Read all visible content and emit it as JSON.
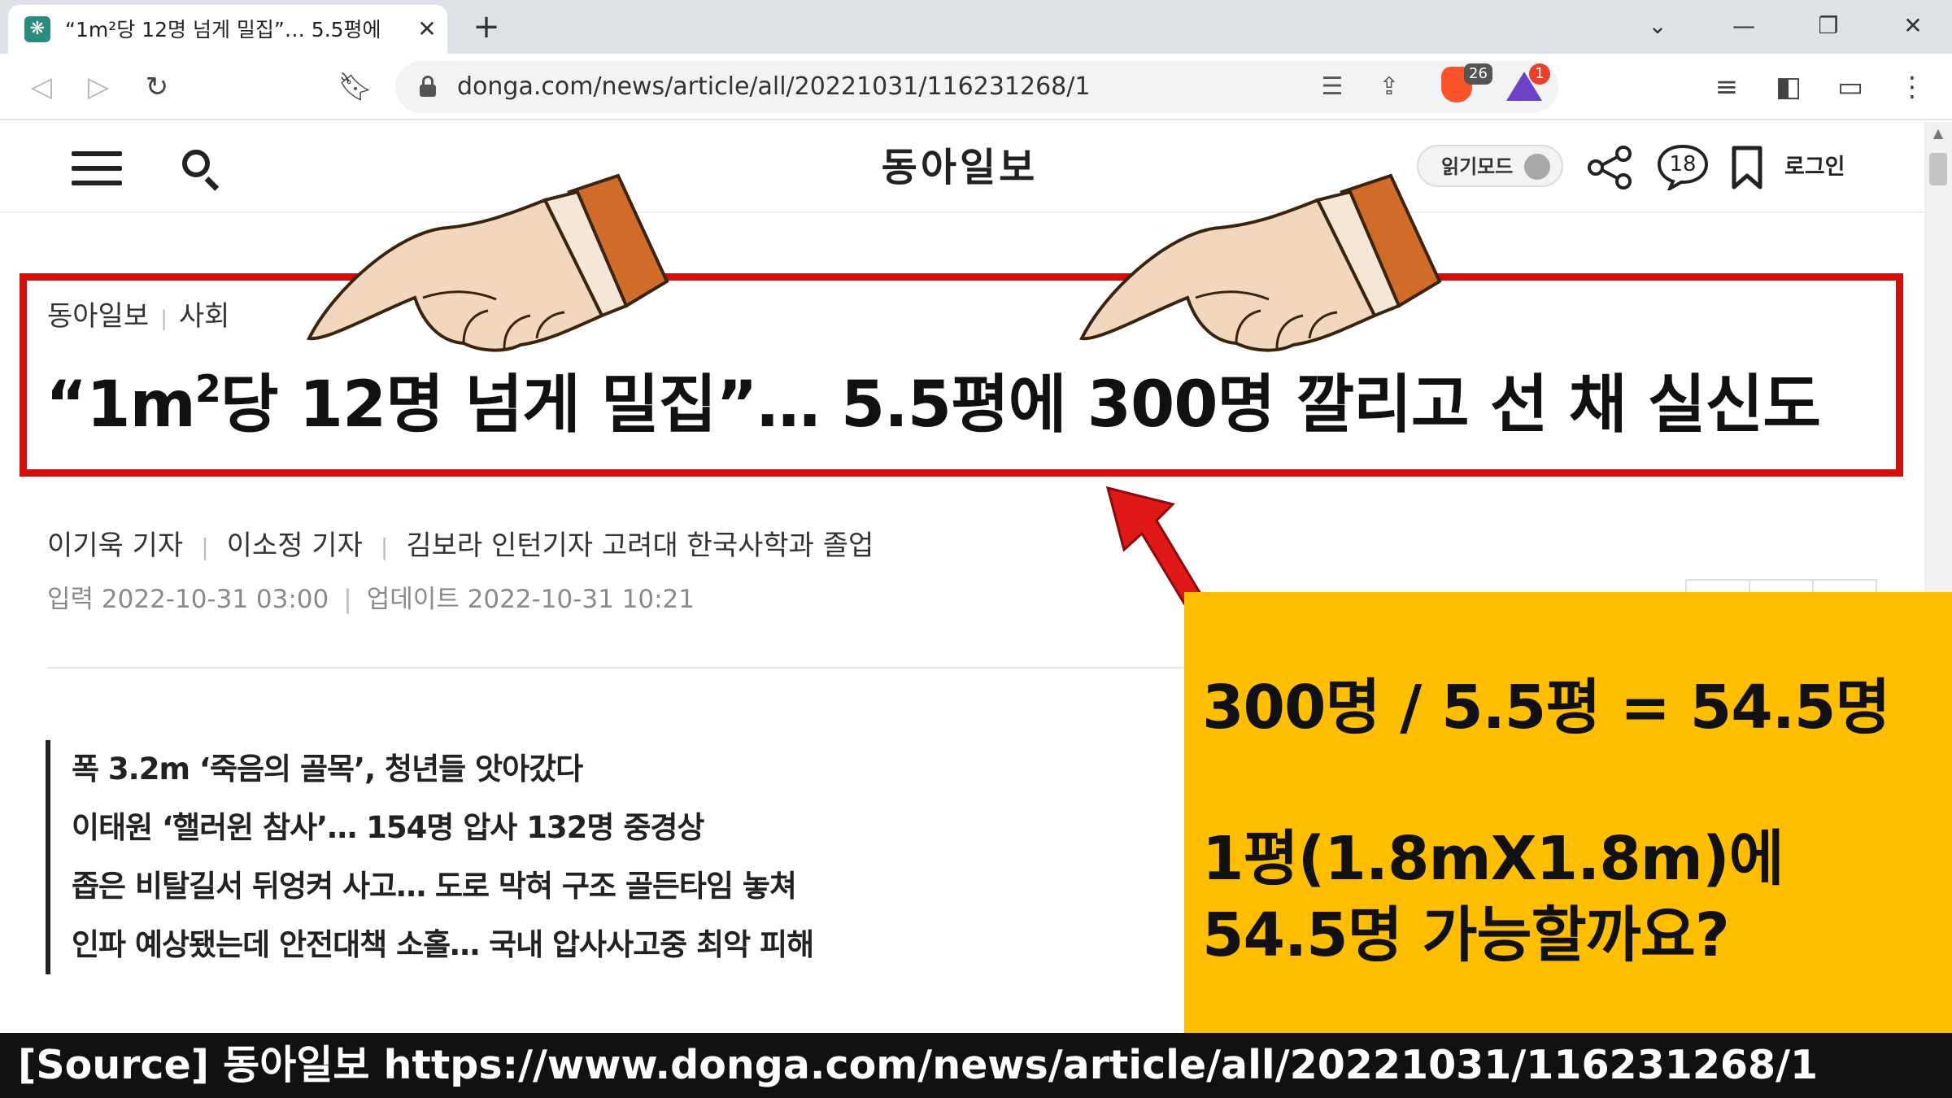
{
  "browser": {
    "tab_title": "“1m²당 12명 넘게 밀집”… 5.5평에",
    "tab_close": "✕",
    "new_tab": "+",
    "url": "donga.com/news/article/all/20221031/116231268/1",
    "brave_badge": "26",
    "rewards_badge": "1"
  },
  "site": {
    "logo": "동아일보",
    "reading_mode_label": "읽기모드",
    "comment_count": "18",
    "login_label": "로그인"
  },
  "article": {
    "breadcrumb": [
      "동아일보",
      "사회"
    ],
    "headline_pre": "“1m",
    "headline_sup": "2",
    "headline_post": "당 12명 넘게 밀집”… 5.5평에 300명 깔리고 선 채 실신도",
    "bylines": [
      "이기욱 기자",
      "이소정 기자",
      "김보라 인턴기자 고려대 한국사학과 졸업"
    ],
    "input_date": "입력 2022-10-31 03:00",
    "update_date": "업데이트 2022-10-31 10:21",
    "related": [
      "폭 3.2m ‘죽음의 골목’, 청년들 앗아갔다",
      "이태원 ‘핼러윈 참사’… 154명 압사 132명 중경상",
      "좁은 비탈길서 뒤엉켜 사고… 도로 막혀 구조 골든타임 놓쳐",
      "인파 예상됐는데 안전대책 소홀… 국내 압사사고중 최악 피해"
    ]
  },
  "callout": {
    "line1": "300명 / 5.5평 = 54.5명",
    "line2": "1평(1.8mX1.8m)에",
    "line3": "54.5명 가능할까요?"
  },
  "source": {
    "text": "[Source] 동아일보   https://www.donga.com/news/article/all/20221031/116231268/1"
  },
  "colors": {
    "highlight_border": "#d40d0d",
    "callout_bg": "#ffbf00",
    "arrow": "#e01818",
    "source_bar": "#111111"
  }
}
